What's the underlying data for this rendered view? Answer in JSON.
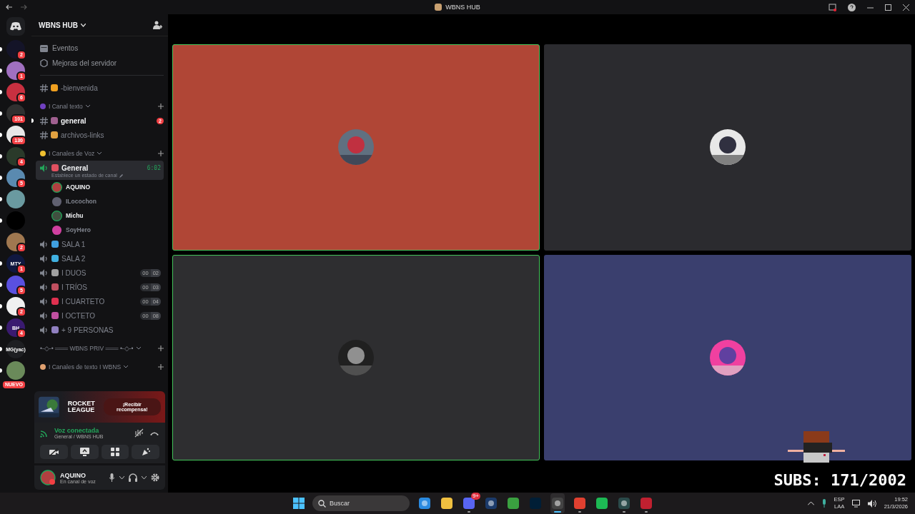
{
  "titlebar": {
    "title": "WBNS HUB"
  },
  "servers": [
    {
      "unread": true,
      "color": "#141428",
      "badge": "2"
    },
    {
      "unread": true,
      "color": "#a070c0",
      "badge": "1"
    },
    {
      "unread": true,
      "color": "#c83040",
      "badge": "6"
    },
    {
      "unread": true,
      "color": "#303030",
      "badge": "101"
    },
    {
      "unread": true,
      "color": "#e8e8e8",
      "badge": "130"
    },
    {
      "unread": true,
      "color": "#2a3a2a",
      "badge": "4"
    },
    {
      "unread": true,
      "color": "#5a8ab0",
      "badge": "5"
    },
    {
      "unread": true,
      "color": "#6a9aa0"
    },
    {
      "unread": true,
      "color": "#000000"
    },
    {
      "unread": false,
      "color": "#a07850",
      "badge": "2"
    },
    {
      "unread": true,
      "color": "#101840",
      "label": "MTY",
      "badge": "1"
    },
    {
      "unread": true,
      "color": "#5a50e0",
      "badge": "5"
    },
    {
      "unread": true,
      "color": "#f0f0f0",
      "badge": "2"
    },
    {
      "unread": true,
      "color": "#3a1a70",
      "label": "BH",
      "badge": "4"
    },
    {
      "unread": true,
      "color": "#1e1f22",
      "label": "MG(yac)"
    },
    {
      "unread": true,
      "color": "#6a8a5a",
      "badge": "NUEVO"
    }
  ],
  "server_header": {
    "name": "WBNS HUB"
  },
  "nav": [
    {
      "label": "Eventos"
    },
    {
      "label": "Mejoras del servidor"
    }
  ],
  "channels": [
    {
      "kind": "text",
      "name": "-bienvenida",
      "color": "#f0a020",
      "unread": false
    },
    {
      "kind": "category",
      "name": "I Canal texto",
      "color": "#7040c0"
    },
    {
      "kind": "text",
      "name": "general",
      "color": "#a06090",
      "unread": true,
      "badge": "2"
    },
    {
      "kind": "text",
      "name": "archivos-links",
      "color": "#e0a040",
      "unread": false
    },
    {
      "kind": "category",
      "name": "I Canales de Voz",
      "color": "#f0c030"
    },
    {
      "kind": "voice",
      "name": "General",
      "color": "#e05060",
      "selected": true,
      "time": "6:02",
      "status": "Establece un estado de canal",
      "members": [
        {
          "name": "AQUINO",
          "speaking": true,
          "color": "#b04040"
        },
        {
          "name": "ILocochon",
          "speaking": false,
          "color": "#606070"
        },
        {
          "name": "Michu",
          "speaking": true,
          "color": "#405040"
        },
        {
          "name": "SoyHero",
          "speaking": false,
          "color": "#d040a0"
        }
      ]
    },
    {
      "kind": "voice",
      "name": "SALA 1",
      "color": "#40a0e0",
      "selected": false
    },
    {
      "kind": "voice",
      "name": "SALA 2",
      "color": "#40b0e0",
      "selected": false
    },
    {
      "kind": "voice",
      "name": "I  DUOS",
      "color": "#a0a0a0",
      "selected": false,
      "users": "00",
      "limit": "02"
    },
    {
      "kind": "voice",
      "name": "I TRÍOS",
      "color": "#c05060",
      "selected": false,
      "users": "00",
      "limit": "03"
    },
    {
      "kind": "voice",
      "name": "I CUARTETO",
      "color": "#e03050",
      "selected": false,
      "users": "00",
      "limit": "04"
    },
    {
      "kind": "voice",
      "name": "I  OCTETO",
      "color": "#c050a0",
      "selected": false,
      "users": "00",
      "limit": "08"
    },
    {
      "kind": "voice",
      "name": "+ 9 PERSONAS",
      "color": "#9080c0",
      "selected": false
    },
    {
      "kind": "category",
      "name": "•-◇-• ═══ WBNS PRIV ═══ •-◇-•"
    },
    {
      "kind": "category",
      "name": "I Canales de texto I WBNS",
      "color": "#e0a070"
    }
  ],
  "promo": {
    "logo_lines": [
      "ROCKET",
      "LEAGUE"
    ],
    "button": "¡Recibir recompensa!"
  },
  "voice_panel": {
    "status": "Voz conectada",
    "location": "General / WBNS HUB"
  },
  "user": {
    "name": "AQUINO",
    "status": "En canal de voz"
  },
  "tiles": [
    {
      "color": "#b04636",
      "speaking": true
    },
    {
      "color": "#2b2b2f",
      "speaking": false
    },
    {
      "color": "#2e2e30",
      "speaking": true
    },
    {
      "color": "#3a3f6e",
      "speaking": false
    }
  ],
  "overlay": {
    "text": "SUBS: 171/2002"
  },
  "taskbar": {
    "search": {
      "placeholder": "Buscar"
    },
    "apps": [
      {
        "running": false,
        "active": false
      },
      {
        "running": false,
        "active": false
      },
      {
        "running": true,
        "active": false,
        "badge": "9+"
      },
      {
        "running": false,
        "active": false
      },
      {
        "running": false,
        "active": false
      },
      {
        "running": false,
        "active": false
      },
      {
        "running": true,
        "active": true
      },
      {
        "running": true,
        "active": false
      },
      {
        "running": false,
        "active": false
      },
      {
        "running": true,
        "active": false
      },
      {
        "running": true,
        "active": false
      }
    ],
    "lang": "ESP",
    "region": "LAA",
    "time": "19:52",
    "date": "21/3/2026"
  }
}
